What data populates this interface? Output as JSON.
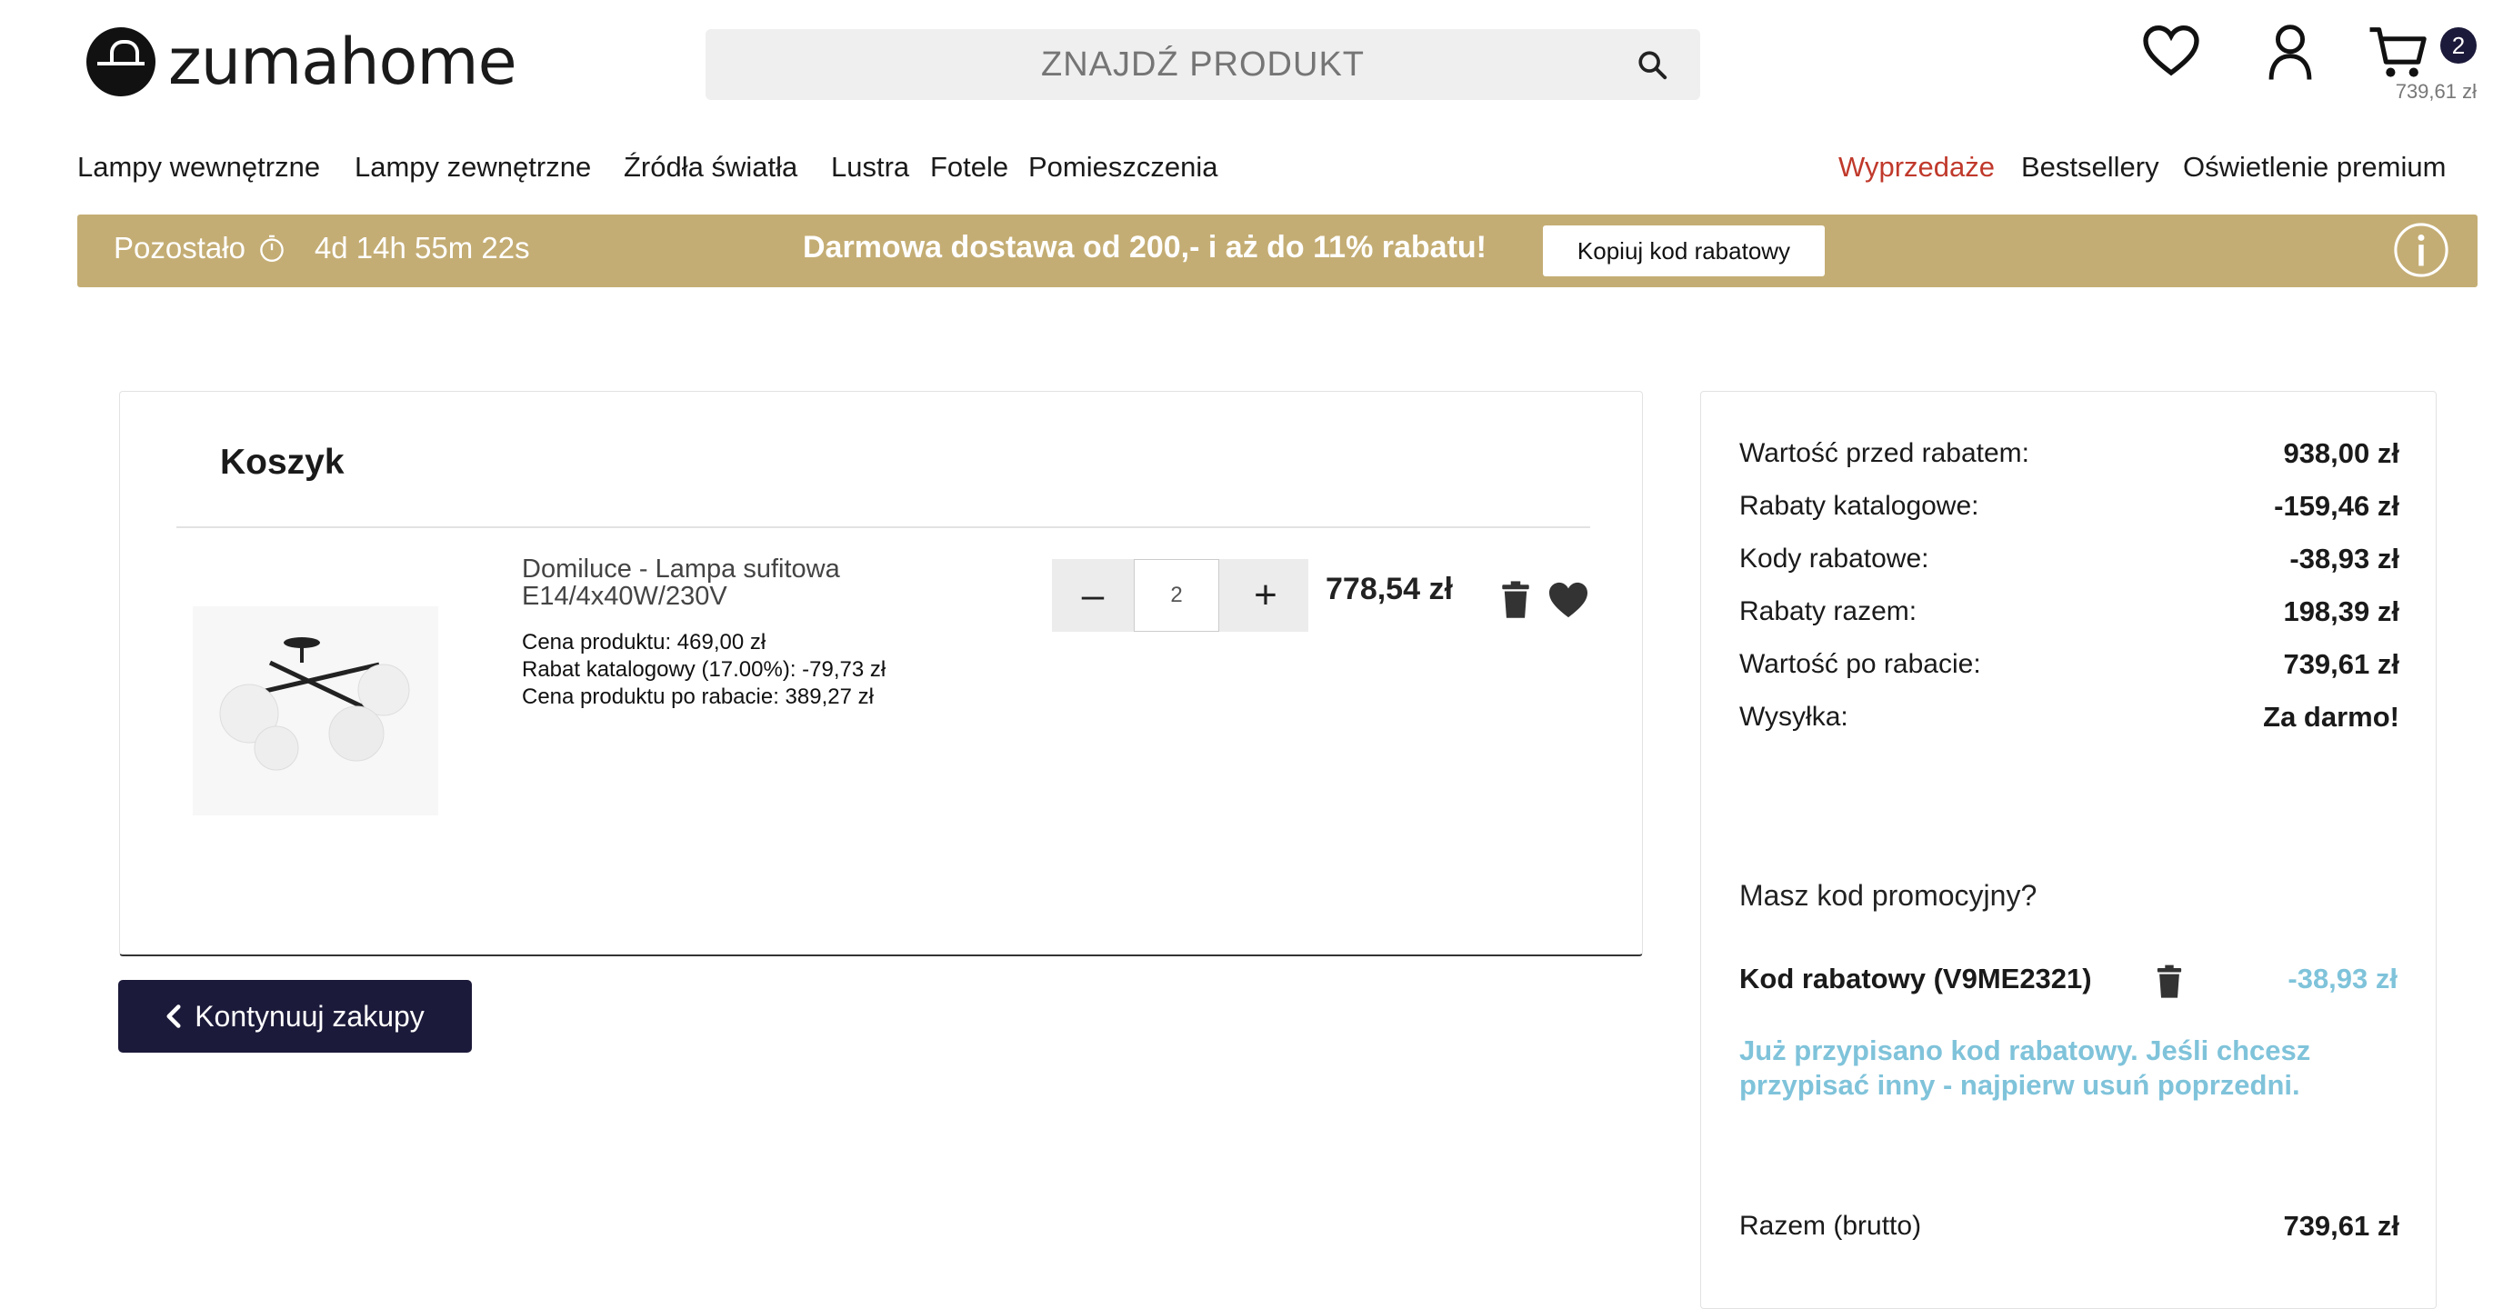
{
  "header": {
    "logo_text": "zumahome",
    "search_placeholder": "ZNAJDŹ PRODUKT",
    "cart_count": "2",
    "cart_total": "739,61 zł"
  },
  "nav": {
    "left": [
      "Lampy wewnętrzne",
      "Lampy zewnętrzne",
      "Źródła światła",
      "Lustra",
      "Fotele",
      "Pomieszczenia"
    ],
    "right": [
      "Wyprzedaże",
      "Bestsellery",
      "Oświetlenie premium"
    ]
  },
  "promo": {
    "remaining_label": "Pozostało",
    "timer": "4d 14h 55m 22s",
    "message": "Darmowa dostawa od 200,- i aż do 11% rabatu!",
    "copy_button": "Kopiuj kod rabatowy"
  },
  "cart": {
    "title": "Koszyk",
    "item": {
      "name": "Domiluce - Lampa sufitowa E14/4x40W/230V",
      "price_line": "Cena produktu: 469,00 zł",
      "discount_line": "Rabat katalogowy (17.00%): -79,73 zł",
      "after_discount_line": "Cena produktu po rabacie: 389,27 zł",
      "quantity": "2",
      "minus": "–",
      "plus": "+",
      "line_total": "778,54 zł"
    },
    "continue_button": "Kontynuuj zakupy"
  },
  "summary": {
    "rows": [
      {
        "label": "Wartość przed rabatem:",
        "value": "938,00 zł"
      },
      {
        "label": "Rabaty katalogowe:",
        "value": "-159,46 zł"
      },
      {
        "label": "Kody rabatowe:",
        "value": "-38,93 zł"
      },
      {
        "label": "Rabaty razem:",
        "value": "198,39 zł"
      },
      {
        "label": "Wartość po rabacie:",
        "value": "739,61 zł"
      },
      {
        "label": "Wysyłka:",
        "value": "Za darmo!"
      }
    ],
    "promo_question": "Masz kod promocyjny?",
    "code_label": "Kod rabatowy (V9ME2321)",
    "code_value": "-38,93 zł",
    "code_note": "Już przypisano kod rabatowy. Jeśli chcesz przypisać inny - najpierw usuń poprzedni.",
    "total_label": "Razem (brutto)",
    "total_value": "739,61 zł"
  },
  "colors": {
    "promo_bar": "#c4ad74",
    "navy": "#1c1a3a",
    "sale_red": "#c0392b",
    "code_blue": "#7fc3da"
  }
}
